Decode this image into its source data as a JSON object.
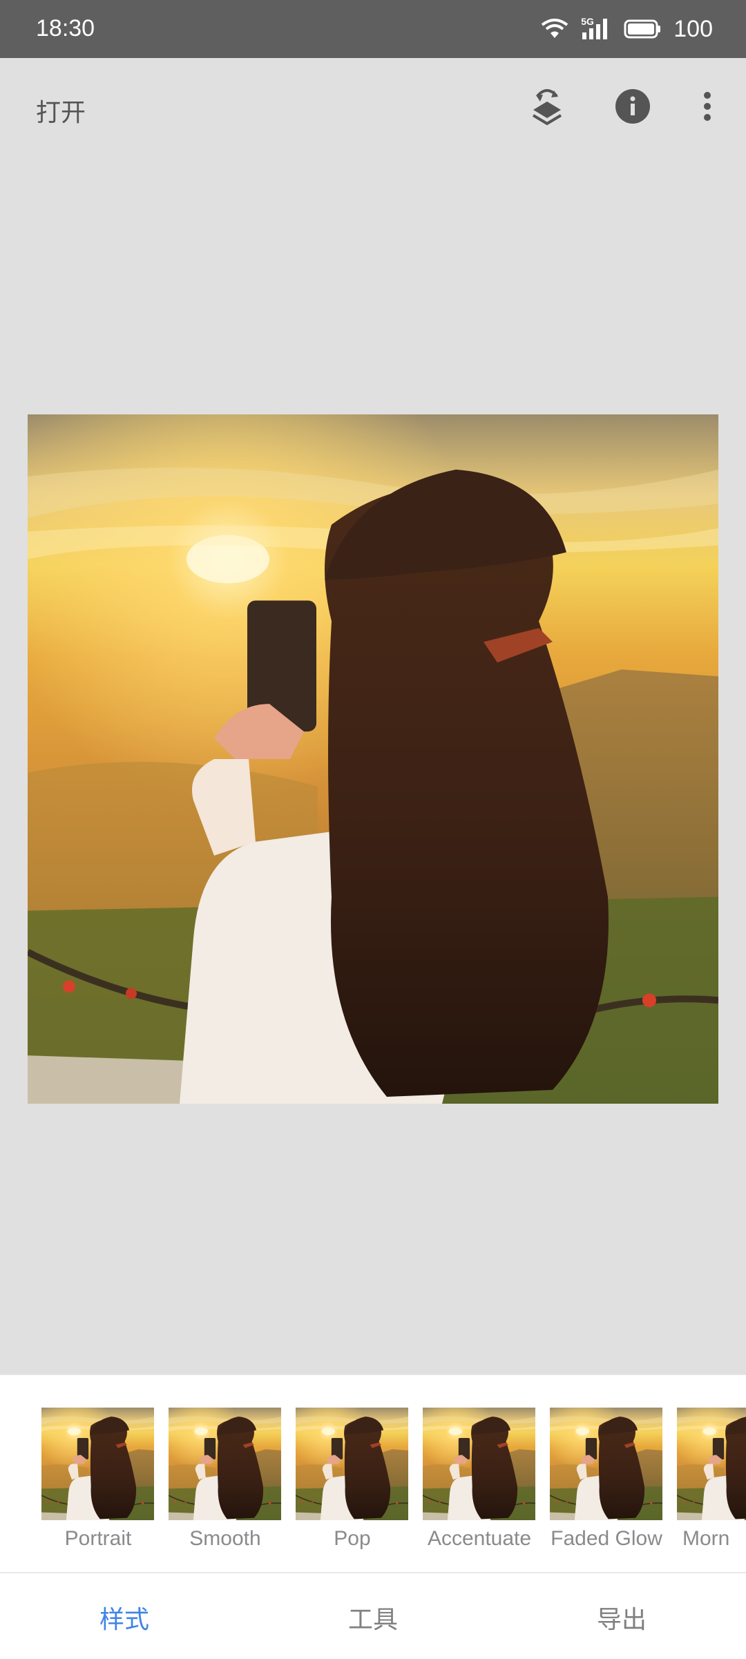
{
  "status_bar": {
    "time": "18:30",
    "network_label": "5G",
    "battery_level": "100",
    "icons": [
      "wifi-icon",
      "cellular-5g-icon",
      "battery-icon"
    ]
  },
  "app_bar": {
    "open_label": "打开",
    "icons": [
      "layers-undo-icon",
      "info-icon",
      "more-vert-icon"
    ]
  },
  "styles": [
    {
      "label": "Portrait"
    },
    {
      "label": "Smooth"
    },
    {
      "label": "Pop"
    },
    {
      "label": "Accentuate"
    },
    {
      "label": "Faded Glow"
    },
    {
      "label": "Morn"
    }
  ],
  "bottom_nav": {
    "tabs": [
      {
        "label": "样式",
        "active": true
      },
      {
        "label": "工具",
        "active": false
      },
      {
        "label": "导出",
        "active": false
      }
    ]
  },
  "colors": {
    "accent": "#3f84e5",
    "status_bar_bg": "#5f5f5f",
    "canvas_bg": "#e0e0e0"
  }
}
